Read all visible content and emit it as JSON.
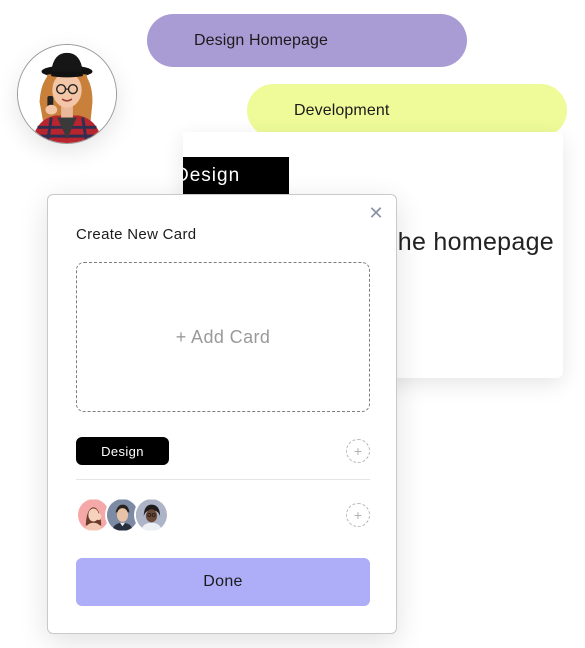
{
  "pills": {
    "design_label": "Design Homepage",
    "development_label": "Development"
  },
  "background_card": {
    "tag": "Design",
    "title": "he homepage"
  },
  "modal": {
    "title": "Create New Card",
    "close_icon": "close-icon",
    "dropzone_label": "+ Add Card",
    "tag_label": "Design",
    "add_tag_icon": "plus-icon",
    "add_member_icon": "plus-icon",
    "done_label": "Done"
  },
  "colors": {
    "pill_design": "#a99bd4",
    "pill_development": "#eefb98",
    "done_button": "#adadf8",
    "tag_background": "#000000"
  }
}
